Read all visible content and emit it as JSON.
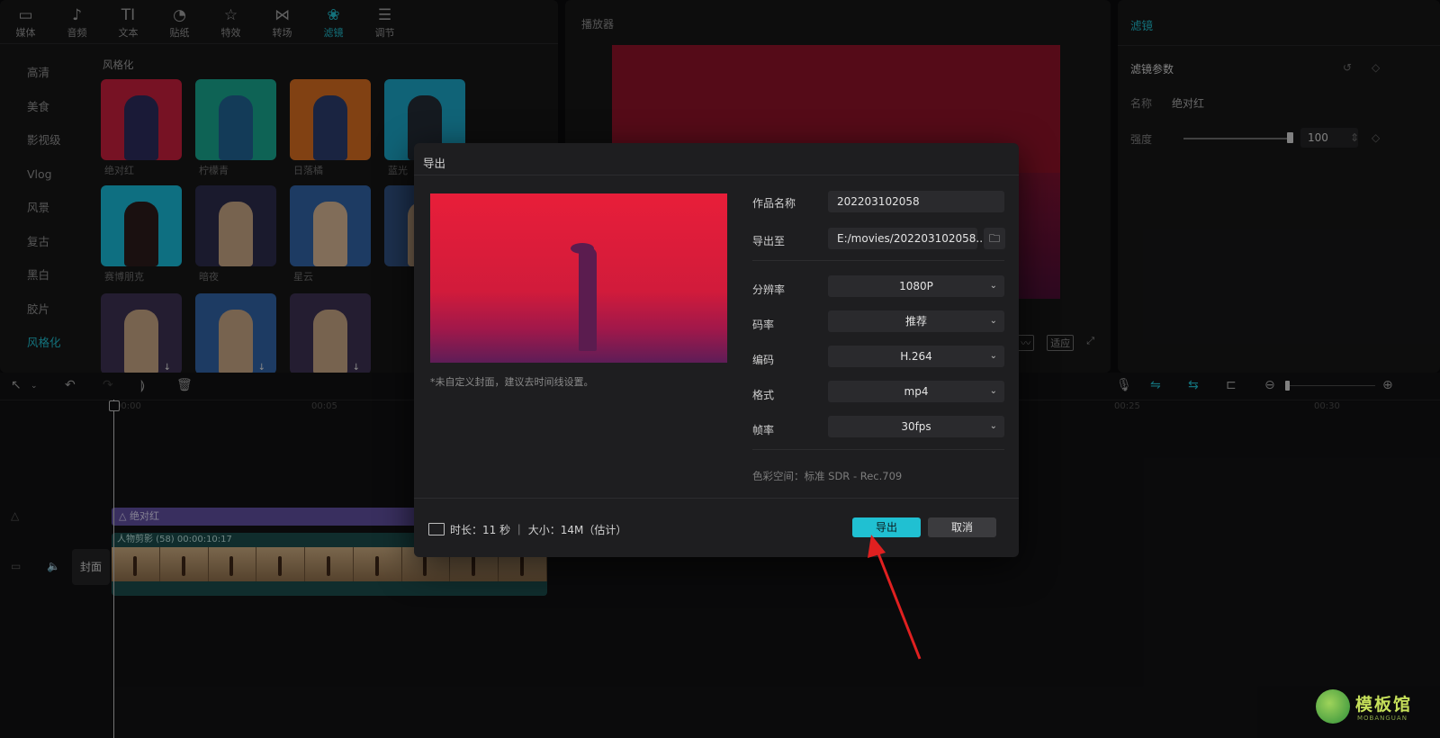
{
  "top_tabs": [
    {
      "label": "媒体",
      "icon": "media-icon",
      "glyph": "▭"
    },
    {
      "label": "音频",
      "icon": "audio-icon",
      "glyph": "♪"
    },
    {
      "label": "文本",
      "icon": "text-icon",
      "glyph": "TI"
    },
    {
      "label": "贴纸",
      "icon": "sticker-icon",
      "glyph": "◔"
    },
    {
      "label": "特效",
      "icon": "effects-icon",
      "glyph": "☆"
    },
    {
      "label": "转场",
      "icon": "transition-icon",
      "glyph": "⋈"
    },
    {
      "label": "滤镜",
      "icon": "filter-icon",
      "glyph": "❀",
      "active": true
    },
    {
      "label": "调节",
      "icon": "adjust-icon",
      "glyph": "☰"
    }
  ],
  "side_nav": [
    "高清",
    "美食",
    "影视级",
    "Vlog",
    "风景",
    "复古",
    "黑白",
    "胶片",
    "风格化"
  ],
  "side_nav_active": "风格化",
  "section_label": "风格化",
  "filters": [
    {
      "label": "绝对红",
      "bg": "#c01d3a",
      "fg": "#2a2a5a"
    },
    {
      "label": "柠檬青",
      "bg": "#17a08a",
      "fg": "#1f5f8f"
    },
    {
      "label": "日落橘",
      "bg": "#d06a20",
      "fg": "#2a3a6a"
    },
    {
      "label": "蓝光",
      "bg": "#1aa0c0",
      "fg": "#222a35"
    },
    {
      "label": "赛博朋克",
      "bg": "#18b3d0",
      "fg": "#2a1a1a"
    },
    {
      "label": "暗夜",
      "bg": "#2a2a4a",
      "fg": "#c0a080"
    },
    {
      "label": "星云",
      "bg": "#2f5fa0",
      "fg": "#d0b090"
    },
    {
      "label": "",
      "bg": "#2f4f80",
      "fg": "#c0a080"
    },
    {
      "label": "",
      "bg": "#3a3050",
      "fg": "#c0a080"
    },
    {
      "label": "",
      "bg": "#2f5fa0",
      "fg": "#c0a080"
    },
    {
      "label": "",
      "bg": "#3a3050",
      "fg": "#c0a080"
    }
  ],
  "player": {
    "title": "播放器",
    "tool_label": "适应"
  },
  "props": {
    "title": "滤镜",
    "subtitle": "滤镜参数",
    "name_label": "名称",
    "name_value": "绝对红",
    "strength_label": "强度",
    "strength_value": "100"
  },
  "timeline": {
    "ruler": [
      "00:00",
      "00:05",
      "00:25",
      "00:30"
    ],
    "filter_clip_label": "绝对红",
    "video_clip_header": "人物剪影 (58)   00:00:10:17",
    "cover_label": "封面"
  },
  "export_dialog": {
    "title": "导出",
    "hint": "*未自定义封面，建议去时间线设置。",
    "fields": {
      "name_label": "作品名称",
      "name_value": "202203102058",
      "path_label": "导出至",
      "path_value": "E:/movies/202203102058...",
      "resolution_label": "分辨率",
      "resolution_value": "1080P",
      "bitrate_label": "码率",
      "bitrate_value": "推荐",
      "codec_label": "编码",
      "codec_value": "H.264",
      "format_label": "格式",
      "format_value": "mp4",
      "fps_label": "帧率",
      "fps_value": "30fps"
    },
    "colorspace": "色彩空间：标准 SDR - Rec.709",
    "footer_info": "时长：11 秒 ｜ 大小：14M（估计）",
    "export_button": "导出",
    "cancel_button": "取消"
  },
  "watermark": {
    "text": "模板馆",
    "sub": "MOBANGUAN"
  },
  "colors": {
    "accent": "#20c0d2",
    "filter_clip": "#5d4d9a",
    "arrow": "#e02020"
  }
}
